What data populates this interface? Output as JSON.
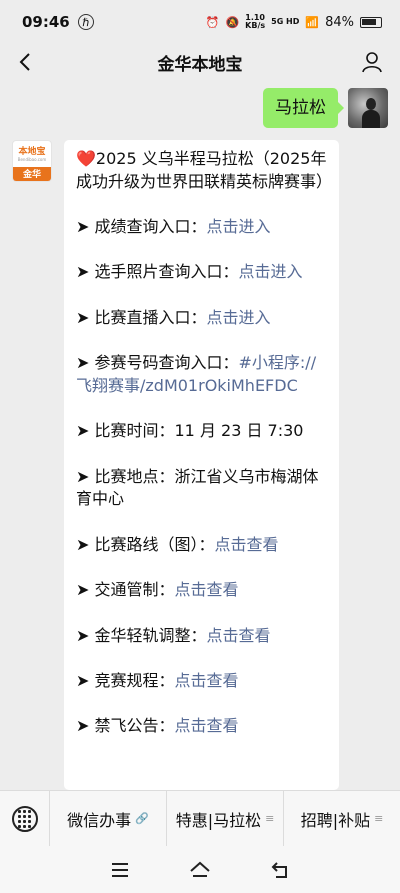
{
  "status": {
    "time": "09:46",
    "net_speed_top": "1.10",
    "net_speed_bottom": "KB/s",
    "network": "5G HD",
    "battery": "84%"
  },
  "nav": {
    "title": "金华本地宝"
  },
  "user_message": "马拉松",
  "bot": {
    "logo_text": "本地宝",
    "logo_sub": "Bendibao.com",
    "logo_city": "金华"
  },
  "bot_message": {
    "heading_icon": "❤️",
    "heading": "2025 义乌半程马拉松（2025年成功升级为世界田联精英标牌赛事）",
    "lines": [
      {
        "prefix": "➤ 成绩查询入口：",
        "link": "点击进入"
      },
      {
        "prefix": "➤ 选手照片查询入口：",
        "link": "点击进入"
      },
      {
        "prefix": "➤ 比赛直播入口：",
        "link": "点击进入"
      },
      {
        "prefix": "➤ 参赛号码查询入口：",
        "link": "#小程序://飞翔赛事/zdM01rOkiMhEFDC"
      },
      {
        "prefix": "➤ 比赛时间：11 月 23 日 7:30",
        "link": ""
      },
      {
        "prefix": "➤ 比赛地点：浙江省义乌市梅湖体育中心",
        "link": ""
      },
      {
        "prefix": "➤ 比赛路线（图）：",
        "link": "点击查看"
      },
      {
        "prefix": "➤ 交通管制：",
        "link": "点击查看"
      },
      {
        "prefix": "➤ 金华轻轨调整：",
        "link": "点击查看"
      },
      {
        "prefix": "➤ 竞赛规程：",
        "link": "点击查看"
      },
      {
        "prefix": "➤ 禁飞公告：",
        "link": "点击查看"
      }
    ]
  },
  "menu": {
    "items": [
      {
        "label": "微信办事",
        "glyph": "🔗"
      },
      {
        "label": "特惠|马拉松",
        "glyph": "≡"
      },
      {
        "label": "招聘|补贴",
        "glyph": "≡"
      }
    ]
  },
  "colors": {
    "user_bubble": "#95ec69",
    "link": "#576b95",
    "logo_orange": "#e8731c"
  }
}
